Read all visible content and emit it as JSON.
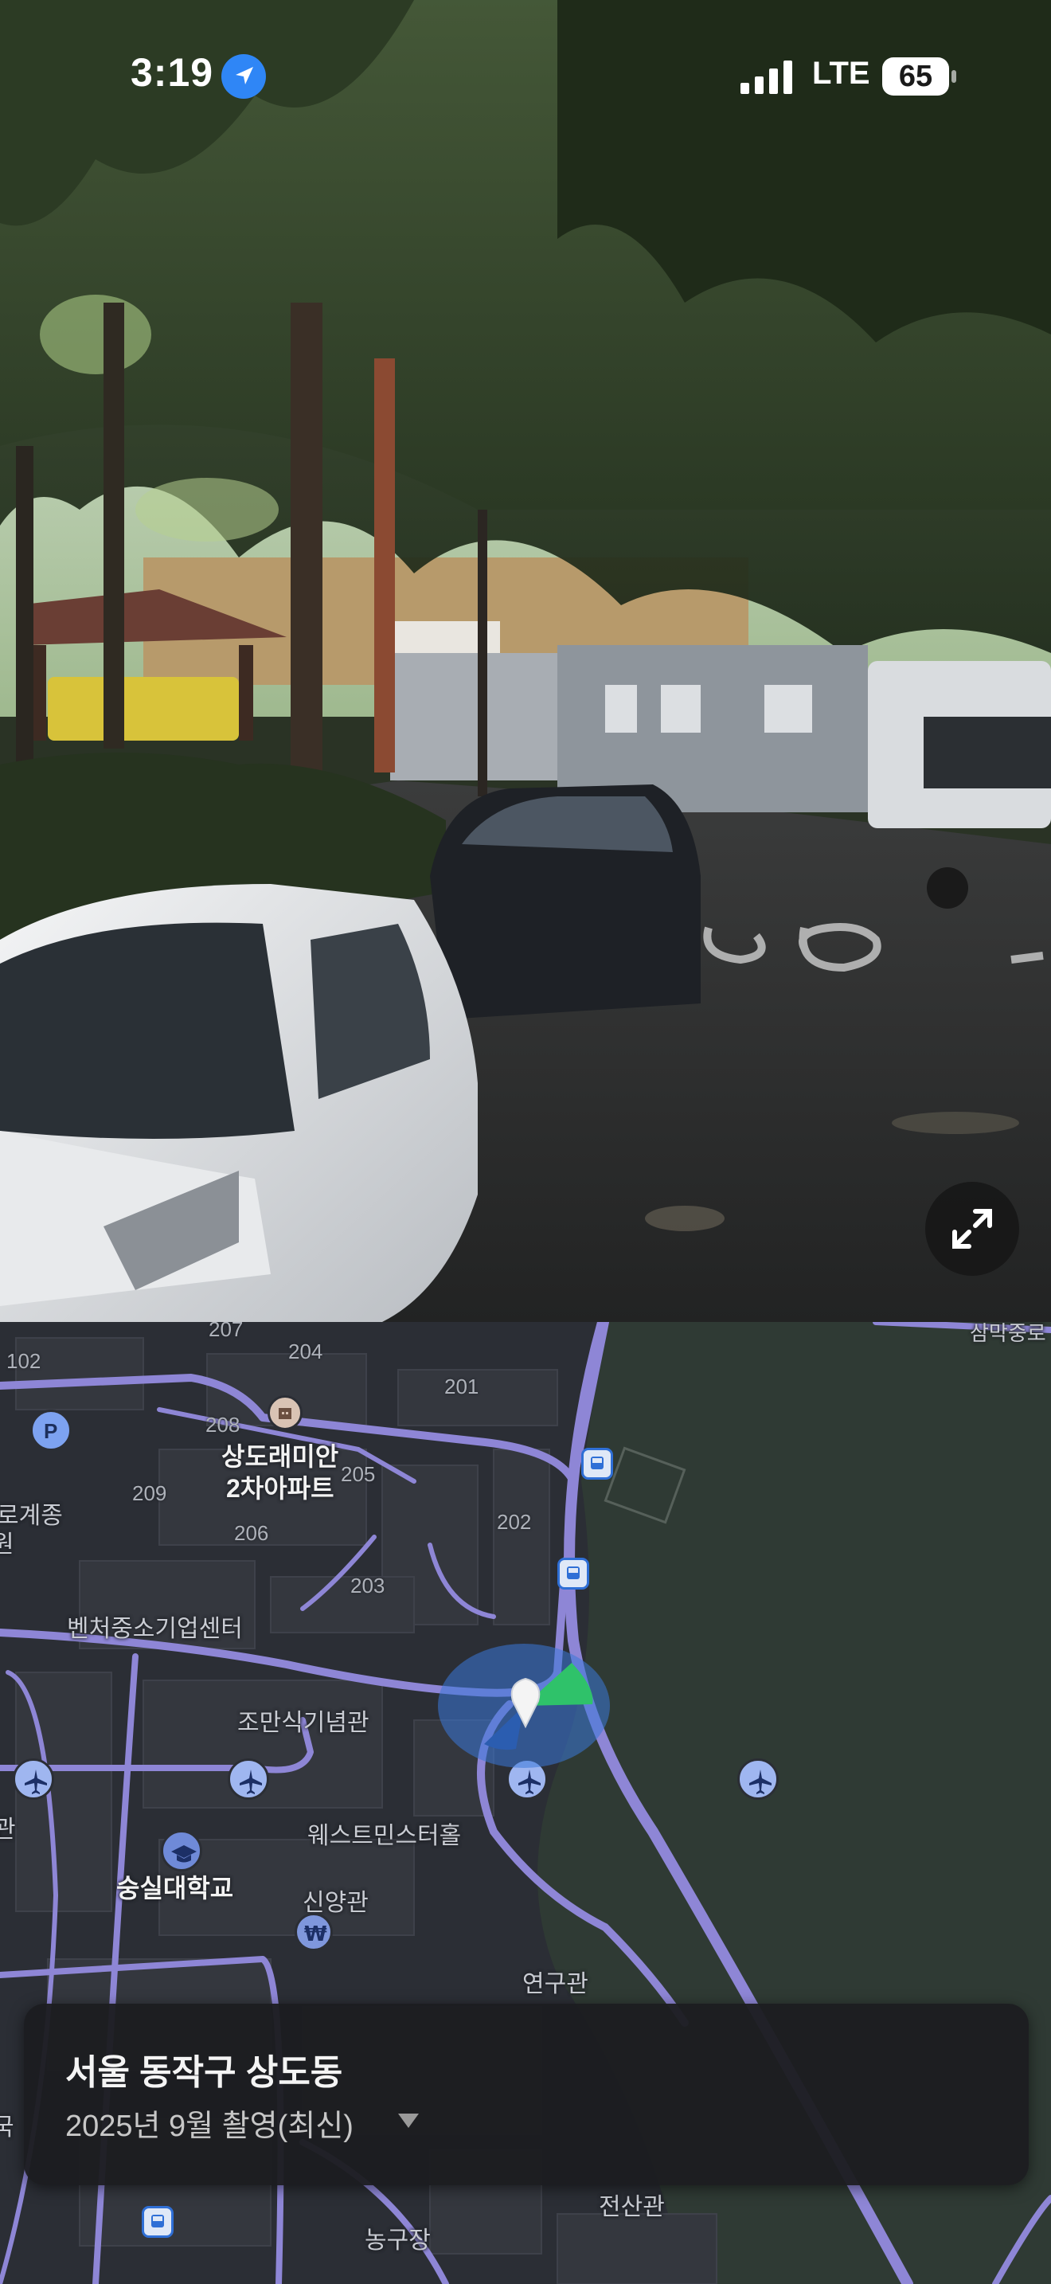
{
  "status_bar": {
    "time": "3:19",
    "network": "LTE",
    "battery": "65",
    "icons": [
      "location-arrow-icon",
      "cellular-signal-icon",
      "battery-icon"
    ]
  },
  "viewer": {
    "expand_icon": "expand-arrows-icon",
    "road_marking": "30"
  },
  "map": {
    "building_numbers": [
      "207",
      "204",
      "102",
      "201",
      "208",
      "205",
      "209",
      "206",
      "202",
      "203"
    ],
    "labels": {
      "apartment_name_line1": "상도래미안",
      "apartment_name_line2": "2차아파트",
      "left_edge_1": "로계종",
      "left_edge_2": "원",
      "venture_center": "벤처중소기업센터",
      "jomansik_hall": "조만식기념관",
      "westminster_hall": "웨스트민스터홀",
      "soongsil_univ": "숭실대학교",
      "sinyang_hall": "신양관",
      "research_hall": "연구관",
      "left_edge_3": "관",
      "left_edge_4": "국",
      "jeonsan_hall": "전산관",
      "sports_field": "농구장",
      "top_right_road": "삼막중로"
    },
    "poi_icons": [
      "parking-icon",
      "building-icon",
      "bus-stop-icon",
      "airplane-icon",
      "graduation-cap-icon",
      "won-currency-icon",
      "user-location-icon"
    ]
  },
  "card": {
    "title": "서울 동작구 상도동",
    "subtitle": "2025년 9월 촬영(최신)"
  },
  "colors": {
    "road": "#8e86d6",
    "park": "#2e3a33",
    "location_cone": "#3a78d8",
    "heading": "#2fc26a"
  }
}
